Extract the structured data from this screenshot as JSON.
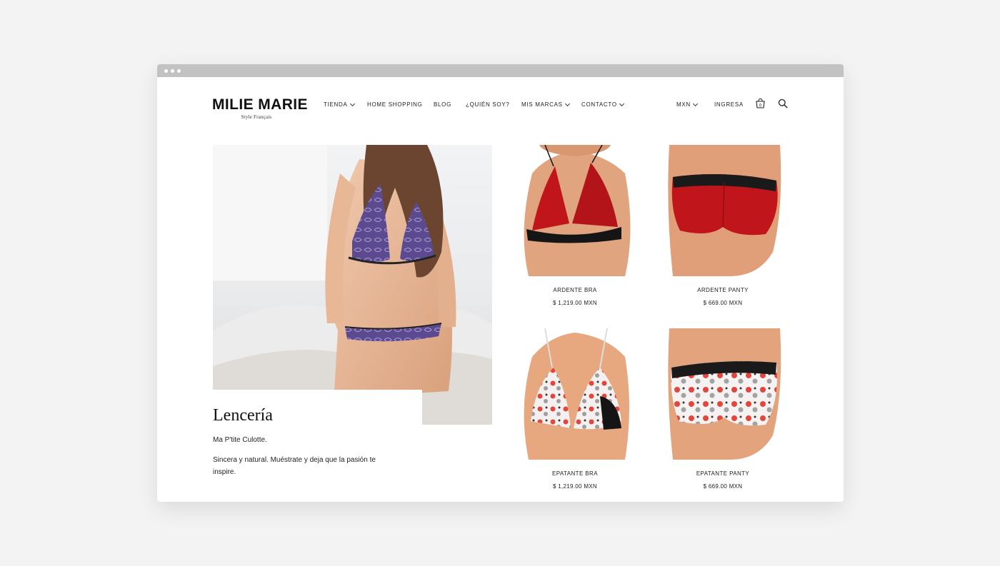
{
  "brand": {
    "name": "MILIE MARIE",
    "tagline": "Style Français"
  },
  "nav": {
    "tienda": "TIENDA",
    "home_shopping": "HOME SHOPPING",
    "blog": "BLOG",
    "quien_soy": "¿QUIÉN SOY?",
    "mis_marcas": "MIS MARCAS",
    "contacto": "CONTACTO",
    "currency": "MXN",
    "login": "INGRESA",
    "cart_count": "0"
  },
  "hero": {
    "title": "Lencería",
    "subtitle": "Ma P'tite Culotte.",
    "description": "Sincera y natural. Muéstrate y deja que la pasión te inspire."
  },
  "products": [
    {
      "name": "ARDENTE BRA",
      "price": "$ 1,219.00 MXN"
    },
    {
      "name": "ARDENTE PANTY",
      "price": "$ 669.00 MXN"
    },
    {
      "name": "EPATANTE BRA",
      "price": "$ 1,219.00 MXN"
    },
    {
      "name": "EPATANTE PANTY",
      "price": "$ 669.00 MXN"
    }
  ],
  "colors": {
    "background": "#f3f3f3",
    "titlebar": "#c2c2c2",
    "text": "#222222"
  },
  "icons": [
    "shopping-bag-icon",
    "search-icon",
    "chevron-down-icon"
  ]
}
